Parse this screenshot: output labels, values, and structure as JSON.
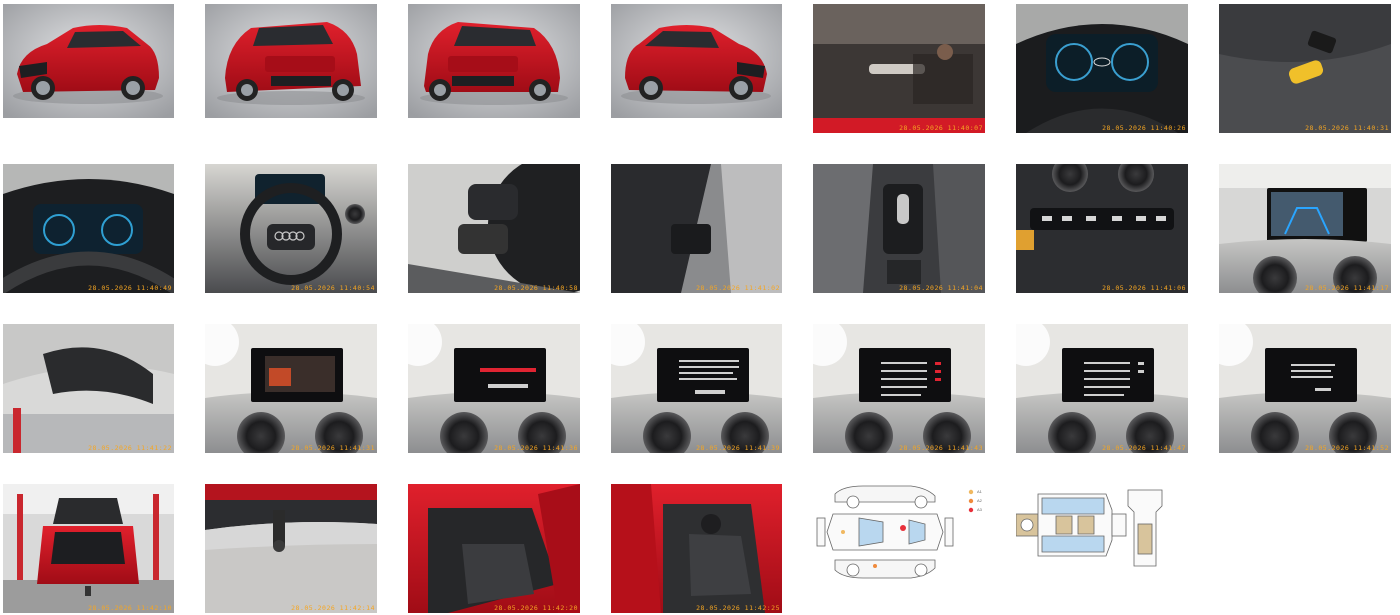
{
  "gallery": {
    "photos": [
      {
        "id": "p01",
        "subject": "exterior-front-left"
      },
      {
        "id": "p02",
        "subject": "exterior-rear-left"
      },
      {
        "id": "p03",
        "subject": "exterior-rear-right"
      },
      {
        "id": "p04",
        "subject": "exterior-front-right"
      },
      {
        "id": "p05",
        "subject": "windshield-badge",
        "stamp": "28.05.2026 11:40:07"
      },
      {
        "id": "p06",
        "subject": "instrument-cluster",
        "stamp": "28.05.2026 11:40:26"
      },
      {
        "id": "p07",
        "subject": "key-on-seat",
        "stamp": "28.05.2026 11:40:31"
      },
      {
        "id": "p08",
        "subject": "cluster-wide",
        "stamp": "28.05.2026 11:40:49"
      },
      {
        "id": "p09",
        "subject": "steering-wheel",
        "stamp": "28.05.2026 11:40:54"
      },
      {
        "id": "p10",
        "subject": "wheel-controls",
        "stamp": "28.05.2026 11:40:58"
      },
      {
        "id": "p11",
        "subject": "door-switches",
        "stamp": "28.05.2026 11:41:02"
      },
      {
        "id": "p12",
        "subject": "gear-selector",
        "stamp": "28.05.2026 11:41:04"
      },
      {
        "id": "p13",
        "subject": "climate-panel",
        "stamp": "28.05.2026 11:41:06"
      },
      {
        "id": "p14",
        "subject": "rear-camera-screen",
        "stamp": "28.05.2026 11:41:17"
      },
      {
        "id": "p15",
        "subject": "mirror-headliner",
        "stamp": "28.05.2026 11:41:22"
      },
      {
        "id": "p16",
        "subject": "infotainment-1",
        "stamp": "28.05.2026 11:41:31"
      },
      {
        "id": "p17",
        "subject": "infotainment-2",
        "stamp": "28.05.2026 11:41:36"
      },
      {
        "id": "p18",
        "subject": "infotainment-3",
        "stamp": "28.05.2026 11:41:39"
      },
      {
        "id": "p19",
        "subject": "infotainment-4",
        "stamp": "28.05.2026 11:41:43"
      },
      {
        "id": "p20",
        "subject": "infotainment-5",
        "stamp": "28.05.2026 11:41:47"
      },
      {
        "id": "p21",
        "subject": "infotainment-6",
        "stamp": "28.05.2026 11:41:52"
      },
      {
        "id": "p22",
        "subject": "open-trunk",
        "stamp": "28.05.2026 11:42:10"
      },
      {
        "id": "p23",
        "subject": "tow-hitch",
        "stamp": "28.05.2026 11:42:14"
      },
      {
        "id": "p24",
        "subject": "rear-door-open",
        "stamp": "28.05.2026 11:42:20"
      },
      {
        "id": "p25",
        "subject": "front-door-open",
        "stamp": "28.05.2026 11:42:25"
      }
    ],
    "damage_diagram_exterior": {
      "legend": [
        {
          "label": "A1",
          "color": "#f0b860"
        },
        {
          "label": "A2",
          "color": "#f08a3c"
        },
        {
          "label": "A3",
          "color": "#e8303a"
        }
      ]
    },
    "damage_diagram_interior": {}
  },
  "colors": {
    "car_red": "#c8101e",
    "studio_grey": "#bfc0c2",
    "stamp": "#f5a623",
    "diagram_blue": "#b9d7ef",
    "diagram_tan": "#d8c49c"
  }
}
